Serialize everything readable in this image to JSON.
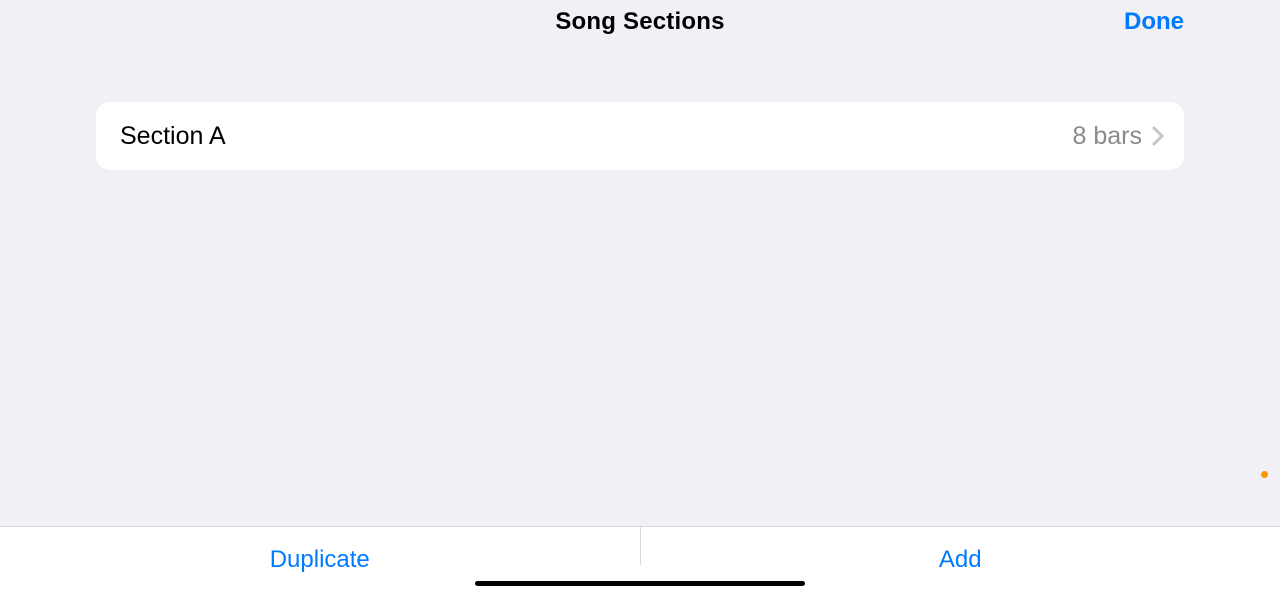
{
  "header": {
    "title": "Song Sections",
    "done_label": "Done"
  },
  "sections": [
    {
      "name": "Section A",
      "bars_label": "8 bars"
    }
  ],
  "toolbar": {
    "duplicate_label": "Duplicate",
    "add_label": "Add"
  }
}
